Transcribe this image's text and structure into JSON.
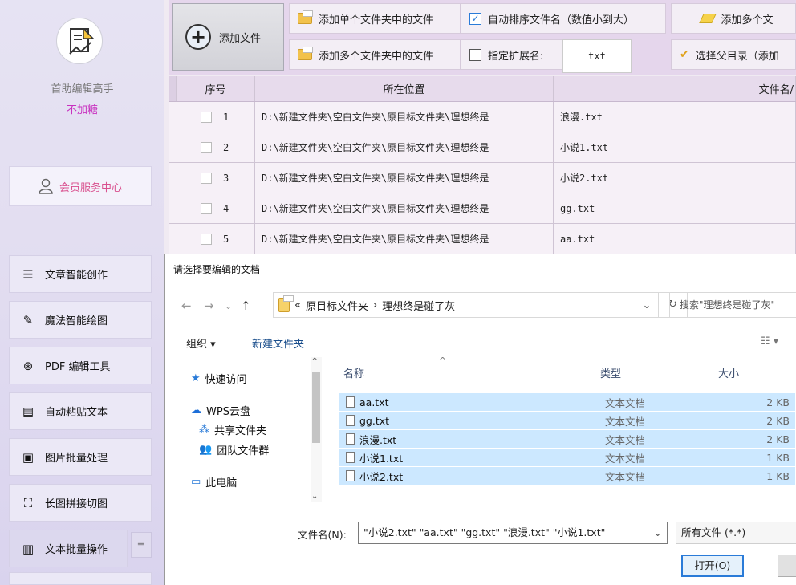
{
  "sidebar": {
    "app_name": "首助编辑高手",
    "app_subtitle": "不加糖",
    "member_center": "会员服务中心",
    "nav": [
      {
        "label": "文章智能创作",
        "icon": "menu-lines-icon"
      },
      {
        "label": "魔法智能绘图",
        "icon": "brush-icon"
      },
      {
        "label": "PDF 编辑工具",
        "icon": "pdf-icon"
      },
      {
        "label": "自动粘贴文本",
        "icon": "document-icon"
      },
      {
        "label": "图片批量处理",
        "icon": "image-icon"
      },
      {
        "label": "长图拼接切图",
        "icon": "crop-icon"
      },
      {
        "label": "文本批量操作",
        "icon": "book-icon"
      }
    ]
  },
  "toolbar": {
    "add_file": "添加文件",
    "add_single_folder": "添加单个文件夹中的文件",
    "add_multi_folder": "添加多个文件夹中的文件",
    "auto_sort": "自动排序文件名（数值小到大）",
    "auto_sort_checked": true,
    "specify_ext": "指定扩展名:",
    "specify_ext_checked": false,
    "ext_value": "txt",
    "add_multi_files": "添加多个文",
    "select_parent": "选择父目录（添加"
  },
  "grid": {
    "columns": [
      "序号",
      "所在位置",
      "文件名/"
    ],
    "rows": [
      {
        "no": "1",
        "path": "D:\\新建文件夹\\空白文件夹\\原目标文件夹\\理想终是",
        "name": "浪漫.txt"
      },
      {
        "no": "2",
        "path": "D:\\新建文件夹\\空白文件夹\\原目标文件夹\\理想终是",
        "name": "小说1.txt"
      },
      {
        "no": "3",
        "path": "D:\\新建文件夹\\空白文件夹\\原目标文件夹\\理想终是",
        "name": "小说2.txt"
      },
      {
        "no": "4",
        "path": "D:\\新建文件夹\\空白文件夹\\原目标文件夹\\理想终是",
        "name": "gg.txt"
      },
      {
        "no": "5",
        "path": "D:\\新建文件夹\\空白文件夹\\原目标文件夹\\理想终是",
        "name": "aa.txt"
      }
    ]
  },
  "dialog": {
    "title": "请选择要编辑的文档",
    "breadcrumb_prefix": "«",
    "breadcrumb": [
      "原目标文件夹",
      "理想终是碰了灰"
    ],
    "search_placeholder": "搜索\"理想终是碰了灰\"",
    "organize": "组织 ▾",
    "new_folder": "新建文件夹",
    "tree": [
      {
        "label": "快速访问",
        "icon": "star-icon"
      },
      {
        "label": "WPS云盘",
        "icon": "cloud-icon"
      },
      {
        "label": "共享文件夹",
        "icon": "share-icon"
      },
      {
        "label": "团队文件群",
        "icon": "team-icon"
      },
      {
        "label": "此电脑",
        "icon": "computer-icon"
      }
    ],
    "columns": [
      "名称",
      "类型",
      "大小"
    ],
    "files": [
      {
        "name": "aa.txt",
        "type": "文本文档",
        "size": "2 KB"
      },
      {
        "name": "gg.txt",
        "type": "文本文档",
        "size": "2 KB"
      },
      {
        "name": "浪漫.txt",
        "type": "文本文档",
        "size": "2 KB"
      },
      {
        "name": "小说1.txt",
        "type": "文本文档",
        "size": "1 KB"
      },
      {
        "name": "小说2.txt",
        "type": "文本文档",
        "size": "1 KB"
      }
    ],
    "filename_label": "文件名(N):",
    "filename_value": "\"小说2.txt\" \"aa.txt\" \"gg.txt\" \"浪漫.txt\" \"小说1.txt\"",
    "filetype": "所有文件 (*.*)",
    "open": "打开(O)"
  }
}
